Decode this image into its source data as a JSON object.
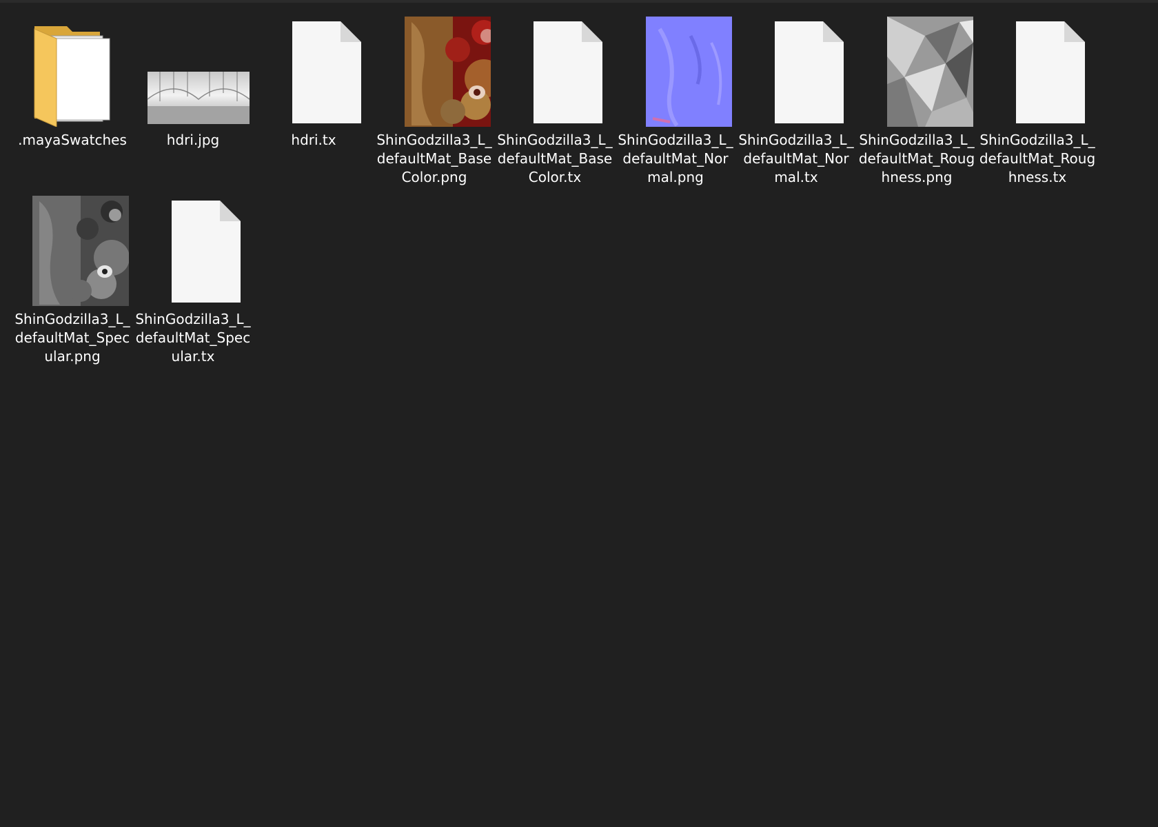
{
  "colors": {
    "background": "#202020",
    "text": "#ffffff",
    "folder": "#f0c35a",
    "document": "#f6f6f6"
  },
  "files": [
    {
      "name": ".mayaSwatches",
      "label": ".mayaSwatches",
      "icon": "folder-icon"
    },
    {
      "name": "hdri.jpg",
      "label": "hdri.jpg",
      "icon": "hdri-thumbnail"
    },
    {
      "name": "hdri.tx",
      "label": "hdri.tx",
      "icon": "document-icon"
    },
    {
      "name": "ShinGodzilla3_L_defaultMat_BaseColor.png",
      "label": "ShinGodzilla3_L_\ndefaultMat_Base\nColor.png",
      "icon": "basecolor-thumbnail"
    },
    {
      "name": "ShinGodzilla3_L_defaultMat_BaseColor.tx",
      "label": "ShinGodzilla3_L_\ndefaultMat_Base\nColor.tx",
      "icon": "document-icon"
    },
    {
      "name": "ShinGodzilla3_L_defaultMat_Normal.png",
      "label": "ShinGodzilla3_L_\ndefaultMat_Nor\nmal.png",
      "icon": "normal-map-thumbnail"
    },
    {
      "name": "ShinGodzilla3_L_defaultMat_Normal.tx",
      "label": "ShinGodzilla3_L_\ndefaultMat_Nor\nmal.tx",
      "icon": "document-icon"
    },
    {
      "name": "ShinGodzilla3_L_defaultMat_Roughness.png",
      "label": "ShinGodzilla3_L_\ndefaultMat_Roug\nhness.png",
      "icon": "roughness-thumbnail"
    },
    {
      "name": "ShinGodzilla3_L_defaultMat_Roughness.tx",
      "label": "ShinGodzilla3_L_\ndefaultMat_Roug\nhness.tx",
      "icon": "document-icon"
    },
    {
      "name": "ShinGodzilla3_L_defaultMat_Specular.png",
      "label": "ShinGodzilla3_L_\ndefaultMat_Spec\nular.png",
      "icon": "specular-thumbnail"
    },
    {
      "name": "ShinGodzilla3_L_defaultMat_Specular.tx",
      "label": "ShinGodzilla3_L_\ndefaultMat_Spec\nular.tx",
      "icon": "document-icon"
    }
  ]
}
